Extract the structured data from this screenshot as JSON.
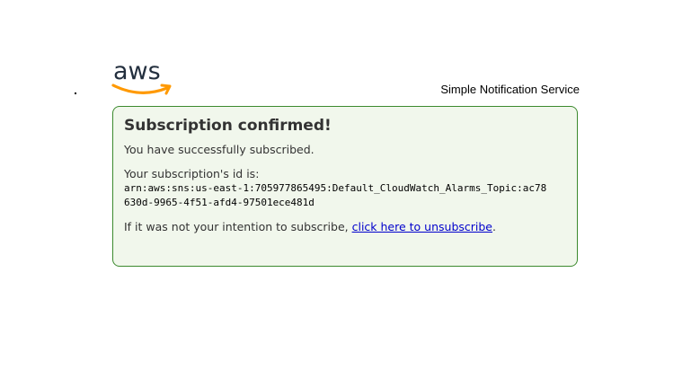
{
  "header": {
    "logo_icon": "aws-logo-icon",
    "logo_text": "aws",
    "service_name": "Simple Notification Service",
    "logo_colors": {
      "text": "#232f3e",
      "smile": "#ff9900"
    }
  },
  "card": {
    "title": "Subscription confirmed!",
    "success_text": "You have successfully subscribed.",
    "id_label": "Your subscription's id is:",
    "subscription_arn": "arn:aws:sns:us-east-1:705977865495:Default_CloudWatch_Alarms_Topic:ac78630d-9965-4f51-afd4-97501ece481d",
    "intent_prefix": "If it was not your intention to subscribe, ",
    "unsubscribe_link": "click here to unsubscribe",
    "intent_suffix": ".",
    "colors": {
      "background": "#f1f7ec",
      "border": "#3c8a2e",
      "link": "#0000cc"
    }
  }
}
